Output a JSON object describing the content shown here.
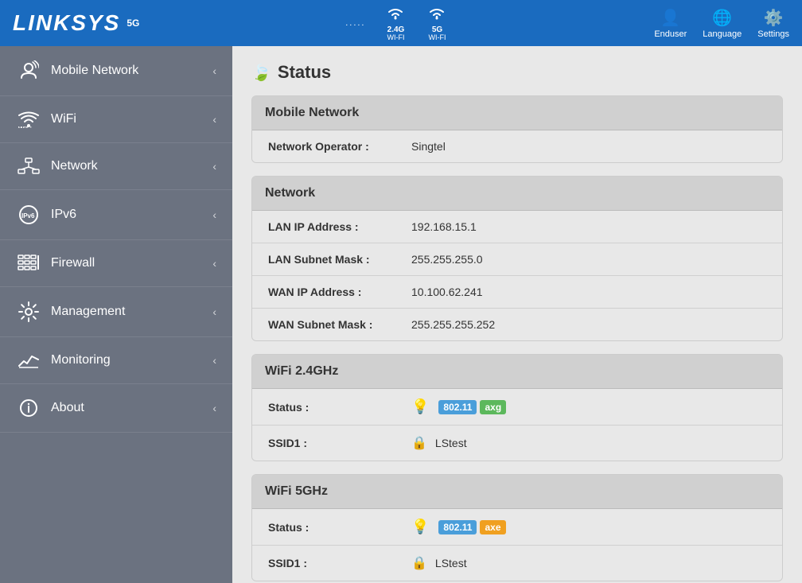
{
  "header": {
    "logo": "LINKSYS",
    "badge": "5G",
    "wifi_dots": ".....",
    "wifi_2g_label": "2.4G\nWI-FI",
    "wifi_5g_label": "5G\nWI-FI",
    "enduser_label": "Enduser",
    "language_label": "Language",
    "settings_label": "Settings"
  },
  "sidebar": {
    "items": [
      {
        "id": "mobile-network",
        "label": "Mobile Network"
      },
      {
        "id": "wifi",
        "label": "WiFi"
      },
      {
        "id": "network",
        "label": "Network"
      },
      {
        "id": "ipv6",
        "label": "IPv6"
      },
      {
        "id": "firewall",
        "label": "Firewall"
      },
      {
        "id": "management",
        "label": "Management"
      },
      {
        "id": "monitoring",
        "label": "Monitoring"
      },
      {
        "id": "about",
        "label": "About"
      }
    ]
  },
  "content": {
    "page_title": "Status",
    "sections": [
      {
        "id": "mobile-network-section",
        "title": "Mobile Network",
        "rows": [
          {
            "label": "Network Operator :",
            "value": "Singtel"
          }
        ]
      },
      {
        "id": "network-section",
        "title": "Network",
        "rows": [
          {
            "label": "LAN IP Address :",
            "value": "192.168.15.1"
          },
          {
            "label": "LAN Subnet Mask :",
            "value": "255.255.255.0"
          },
          {
            "label": "WAN IP Address :",
            "value": "10.100.62.241"
          },
          {
            "label": "WAN Subnet Mask :",
            "value": "255.255.255.252"
          }
        ]
      },
      {
        "id": "wifi-24-section",
        "title": "WiFi 2.4GHz",
        "status_label": "Status :",
        "status_badge_main": "802.11",
        "status_badge_sub": "axg",
        "ssid_label": "SSID1 :",
        "ssid_value": "LStest"
      },
      {
        "id": "wifi-5-section",
        "title": "WiFi 5GHz",
        "status_label": "Status :",
        "status_badge_main": "802.11",
        "status_badge_sub": "axe",
        "ssid_label": "SSID1 :",
        "ssid_value": "LStest"
      }
    ]
  }
}
